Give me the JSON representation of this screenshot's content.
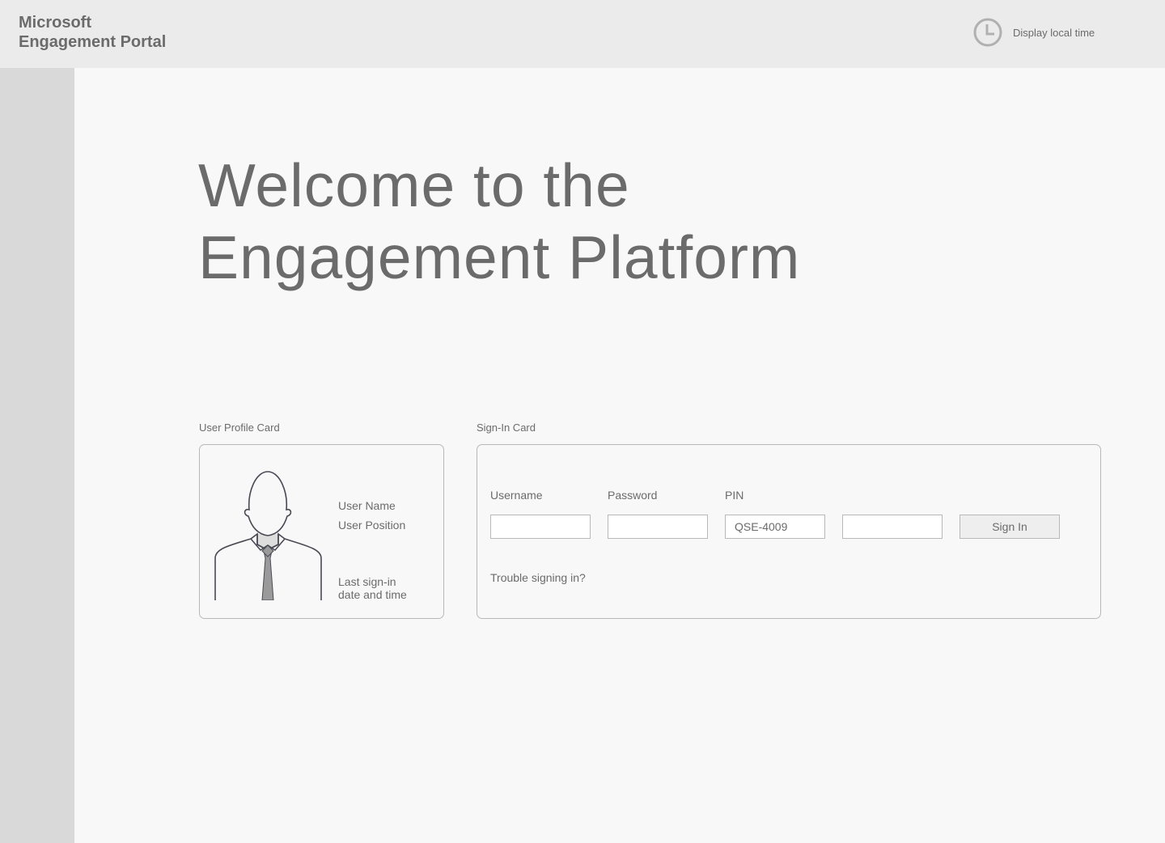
{
  "header": {
    "brand_line1": "Microsoft",
    "brand_line2": "Engagement Portal",
    "clock_icon": "clock-icon",
    "clock_label": "Display local time"
  },
  "main": {
    "welcome_line1": "Welcome to the",
    "welcome_line2": "Engagement Platform"
  },
  "profile_card": {
    "caption": "User Profile Card",
    "avatar_icon": "user-avatar-icon",
    "user_name": "User Name",
    "user_position": "User Position",
    "last_signin_line1": "Last sign-in",
    "last_signin_line2": "date and time"
  },
  "signin_card": {
    "caption": "Sign-In Card",
    "username_label": "Username",
    "username_value": "",
    "password_label": "Password",
    "password_value": "",
    "pin_label": "PIN",
    "pin_value": "QSE-4009",
    "pin_extra_value": "",
    "signin_button": "Sign In",
    "trouble_link": "Trouble signing in?"
  },
  "colors": {
    "topbar": "#ebebeb",
    "sidebar": "#d9d9d9",
    "background": "#f8f8f8",
    "text": "#6b6b6b",
    "border": "#b8b8b8"
  }
}
